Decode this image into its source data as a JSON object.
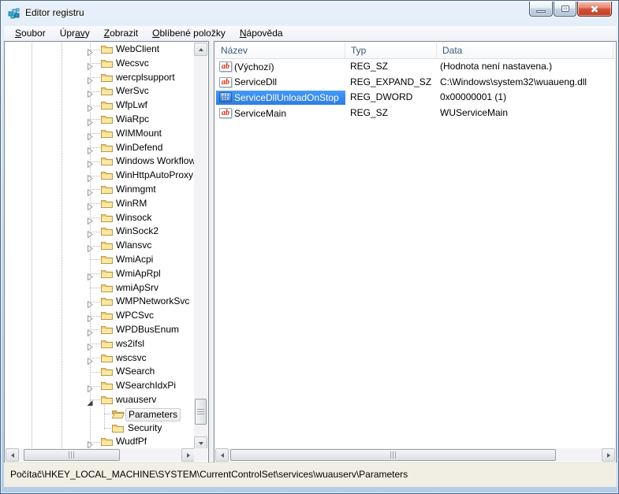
{
  "window": {
    "title": "Editor registru",
    "controls": {
      "minimize": "minimize",
      "restore": "restore",
      "close": "close"
    }
  },
  "menu": {
    "items": [
      {
        "id": "soubor",
        "pre": "",
        "key": "S",
        "post": "oubor"
      },
      {
        "id": "upravy",
        "pre": "Úpr",
        "key": "av",
        "post": "y"
      },
      {
        "id": "zobrazit",
        "pre": "",
        "key": "Z",
        "post": "obrazit"
      },
      {
        "id": "oblibene-polozky",
        "pre": "",
        "key": "O",
        "post": "blíbené položky"
      },
      {
        "id": "napoveda",
        "pre": "",
        "key": "N",
        "post": "ápověda"
      }
    ]
  },
  "tree": {
    "items": [
      {
        "label": "WebClient",
        "expander": "collapsed",
        "level": 1
      },
      {
        "label": "Wecsvc",
        "expander": "collapsed",
        "level": 1
      },
      {
        "label": "wercplsupport",
        "expander": "collapsed",
        "level": 1
      },
      {
        "label": "WerSvc",
        "expander": "collapsed",
        "level": 1
      },
      {
        "label": "WfpLwf",
        "expander": "collapsed",
        "level": 1
      },
      {
        "label": "WiaRpc",
        "expander": "collapsed",
        "level": 1
      },
      {
        "label": "WIMMount",
        "expander": "collapsed",
        "level": 1
      },
      {
        "label": "WinDefend",
        "expander": "collapsed",
        "level": 1
      },
      {
        "label": "Windows Workflow",
        "expander": "collapsed",
        "level": 1
      },
      {
        "label": "WinHttpAutoProxy",
        "expander": "collapsed",
        "level": 1
      },
      {
        "label": "Winmgmt",
        "expander": "collapsed",
        "level": 1
      },
      {
        "label": "WinRM",
        "expander": "collapsed",
        "level": 1
      },
      {
        "label": "Winsock",
        "expander": "collapsed",
        "level": 1
      },
      {
        "label": "WinSock2",
        "expander": "collapsed",
        "level": 1
      },
      {
        "label": "Wlansvc",
        "expander": "collapsed",
        "level": 1
      },
      {
        "label": "WmiAcpi",
        "expander": "none",
        "level": 1
      },
      {
        "label": "WmiApRpl",
        "expander": "collapsed",
        "level": 1
      },
      {
        "label": "wmiApSrv",
        "expander": "none",
        "level": 1
      },
      {
        "label": "WMPNetworkSvc",
        "expander": "collapsed",
        "level": 1
      },
      {
        "label": "WPCSvc",
        "expander": "collapsed",
        "level": 1
      },
      {
        "label": "WPDBusEnum",
        "expander": "collapsed",
        "level": 1
      },
      {
        "label": "ws2ifsl",
        "expander": "collapsed",
        "level": 1
      },
      {
        "label": "wscsvc",
        "expander": "collapsed",
        "level": 1
      },
      {
        "label": "WSearch",
        "expander": "none",
        "level": 1
      },
      {
        "label": "WSearchIdxPi",
        "expander": "collapsed",
        "level": 1
      },
      {
        "label": "wuauserv",
        "expander": "expanded",
        "level": 1
      },
      {
        "label": "Parameters",
        "expander": "none",
        "level": 2,
        "selected": true
      },
      {
        "label": "Security",
        "expander": "none",
        "level": 2
      },
      {
        "label": "WudfPf",
        "expander": "collapsed",
        "level": 1
      },
      {
        "label": "",
        "expander": "none",
        "level": 1,
        "partial": true
      }
    ]
  },
  "list": {
    "columns": [
      "Název",
      "Typ",
      "Data"
    ],
    "rows": [
      {
        "icon": "string",
        "name": "(Výchozí)",
        "type": "REG_SZ",
        "data": "(Hodnota není nastavena.)",
        "selected": false
      },
      {
        "icon": "string",
        "name": "ServiceDll",
        "type": "REG_EXPAND_SZ",
        "data": "C:\\Windows\\system32\\wuaueng.dll",
        "selected": false
      },
      {
        "icon": "dword",
        "name": "ServiceDllUnloadOnStop",
        "type": "REG_DWORD",
        "data": "0x00000001 (1)",
        "selected": true
      },
      {
        "icon": "string",
        "name": "ServiceMain",
        "type": "REG_SZ",
        "data": "WUServiceMain",
        "selected": false
      }
    ]
  },
  "statusbar": {
    "path": "Počítač\\HKEY_LOCAL_MACHINE\\SYSTEM\\CurrentControlSet\\services\\wuauserv\\Parameters"
  },
  "colors": {
    "selection_blue": "#3b8cf0",
    "titlebar_top": "#e8f1fa",
    "titlebar_bottom": "#b6cde7",
    "folder_yellow": "#efcf6e",
    "string_icon_red": "#d42e12",
    "dword_icon_blue": "#2f6fc2",
    "status_bg": "#f1efe3"
  }
}
